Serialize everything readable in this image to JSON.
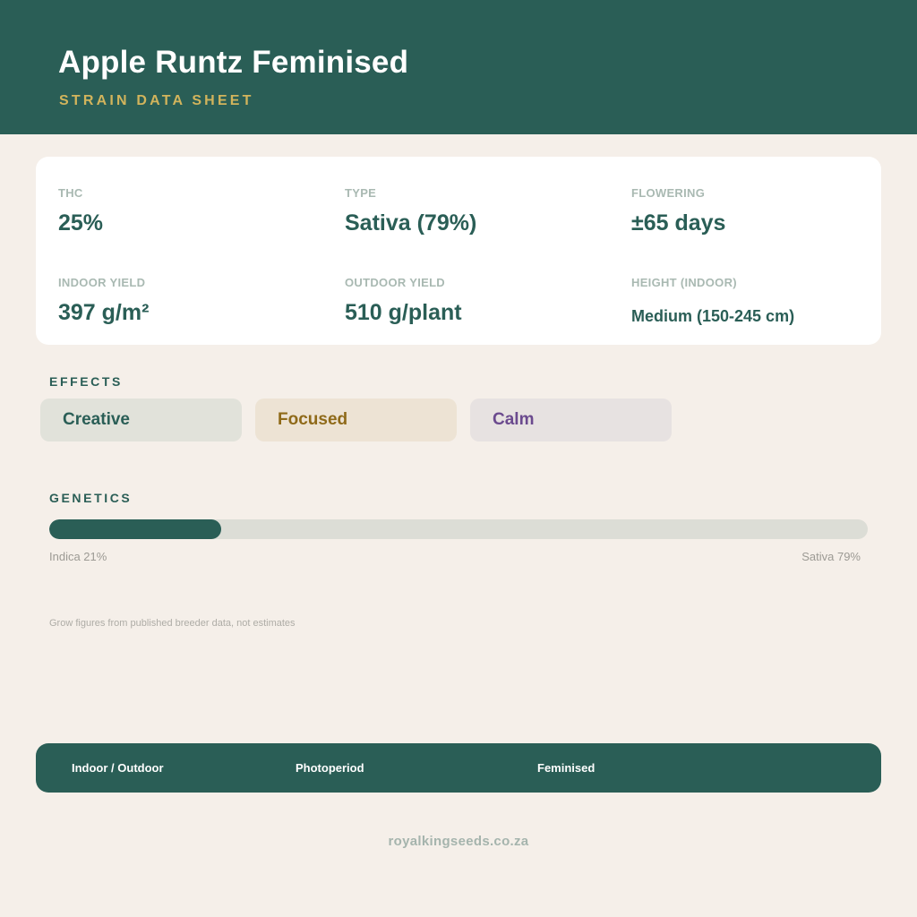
{
  "header": {
    "title": "Apple Runtz Feminised",
    "subtitle": "STRAIN DATA SHEET"
  },
  "stats": [
    {
      "label": "THC",
      "value": "25%"
    },
    {
      "label": "TYPE",
      "value": "Sativa (79%)"
    },
    {
      "label": "FLOWERING",
      "value": "±65 days"
    },
    {
      "label": "INDOOR YIELD",
      "value": "397 g/m²"
    },
    {
      "label": "OUTDOOR YIELD",
      "value": "510 g/plant"
    },
    {
      "label": "HEIGHT (INDOOR)",
      "value": "Medium (150-245 cm)"
    }
  ],
  "effects": {
    "label": "EFFECTS",
    "items": [
      {
        "name": "Creative",
        "color": "#2a5e56",
        "bg": "#e1e2da"
      },
      {
        "name": "Focused",
        "color": "#8f6a19",
        "bg": "#ede3d4"
      },
      {
        "name": "Calm",
        "color": "#6b4a8e",
        "bg": "#e7e2e1"
      }
    ]
  },
  "genetics": {
    "label": "GENETICS",
    "indica_percent": 21,
    "sativa_percent": 79,
    "indica_caption": "Indica 21%",
    "sativa_caption": "Sativa 79%"
  },
  "note": "Grow figures from published breeder data, not estimates",
  "footer": {
    "items": [
      "Indoor / Outdoor",
      "Photoperiod",
      "Feminised"
    ]
  },
  "website": "royalkingseeds.co.za",
  "colors": {
    "brand": "#2a5e56",
    "accent": "#d2b45c",
    "background": "#f5efe9"
  }
}
